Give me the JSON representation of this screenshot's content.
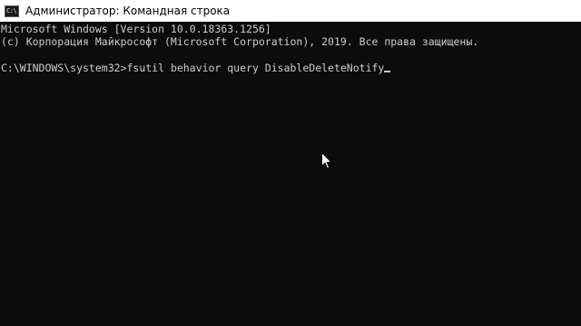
{
  "window": {
    "title": "Администратор: Командная строка",
    "icon": "cmd-icon",
    "icon_glyph": "C:\\"
  },
  "console": {
    "lines": [
      "Microsoft Windows [Version 10.0.18363.1256]",
      "(c) Корпорация Майкрософт (Microsoft Corporation), 2019. Все права защищены."
    ],
    "prompt": "C:\\WINDOWS\\system32>",
    "command": "fsutil behavior query DisableDeleteNotify",
    "text_color": "#cccccc",
    "background_color": "#0c0c0c"
  },
  "pointer": {
    "icon": "mouse-pointer-icon"
  }
}
